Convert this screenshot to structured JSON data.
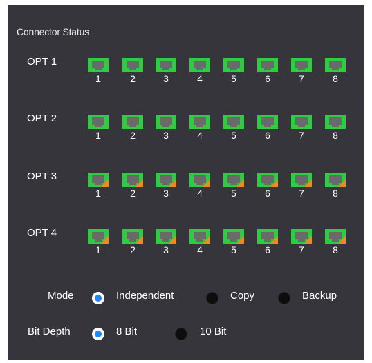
{
  "title": "Connector Status",
  "colors": {
    "port_ok": "#2ecc40",
    "port_warning": "#f08a1c",
    "radio_selected": "#1e88ff",
    "panel_bg": "#35353b"
  },
  "opts": [
    {
      "label": "OPT 1",
      "ports": [
        {
          "num": "1",
          "warning": false
        },
        {
          "num": "2",
          "warning": false
        },
        {
          "num": "3",
          "warning": false
        },
        {
          "num": "4",
          "warning": false
        },
        {
          "num": "5",
          "warning": false
        },
        {
          "num": "6",
          "warning": false
        },
        {
          "num": "7",
          "warning": false
        },
        {
          "num": "8",
          "warning": false
        }
      ]
    },
    {
      "label": "OPT 2",
      "ports": [
        {
          "num": "1",
          "warning": false
        },
        {
          "num": "2",
          "warning": false
        },
        {
          "num": "3",
          "warning": false
        },
        {
          "num": "4",
          "warning": false
        },
        {
          "num": "5",
          "warning": false
        },
        {
          "num": "6",
          "warning": false
        },
        {
          "num": "7",
          "warning": false
        },
        {
          "num": "8",
          "warning": false
        }
      ]
    },
    {
      "label": "OPT 3",
      "ports": [
        {
          "num": "1",
          "warning": true
        },
        {
          "num": "2",
          "warning": true
        },
        {
          "num": "3",
          "warning": true
        },
        {
          "num": "4",
          "warning": true
        },
        {
          "num": "5",
          "warning": true
        },
        {
          "num": "6",
          "warning": true
        },
        {
          "num": "7",
          "warning": true
        },
        {
          "num": "8",
          "warning": true
        }
      ]
    },
    {
      "label": "OPT 4",
      "ports": [
        {
          "num": "1",
          "warning": true
        },
        {
          "num": "2",
          "warning": true
        },
        {
          "num": "3",
          "warning": true
        },
        {
          "num": "4",
          "warning": true
        },
        {
          "num": "5",
          "warning": true
        },
        {
          "num": "6",
          "warning": true
        },
        {
          "num": "7",
          "warning": true
        },
        {
          "num": "8",
          "warning": true
        }
      ]
    }
  ],
  "mode": {
    "label": "Mode",
    "options": [
      {
        "label": "Independent",
        "selected": true
      },
      {
        "label": "Copy",
        "selected": false
      },
      {
        "label": "Backup",
        "selected": false
      }
    ]
  },
  "bit_depth": {
    "label": "Bit Depth",
    "options": [
      {
        "label": "8 Bit",
        "selected": true
      },
      {
        "label": "10 Bit",
        "selected": false
      }
    ]
  }
}
